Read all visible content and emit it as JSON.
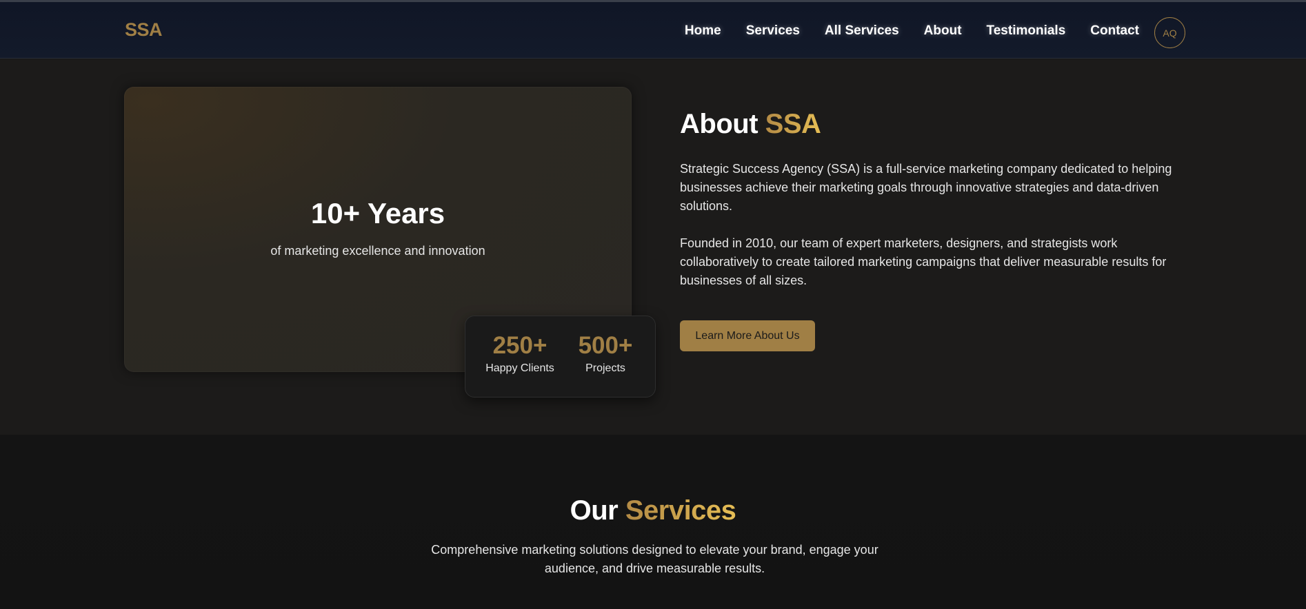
{
  "brand": {
    "logo": "SSA",
    "accent_color": "#a07f45",
    "accent_gradient": [
      "#b38a45",
      "#e6be55"
    ]
  },
  "nav": {
    "links": [
      "Home",
      "Services",
      "All Services",
      "About",
      "Testimonials",
      "Contact"
    ],
    "avatar_initials": "AQ"
  },
  "about": {
    "card": {
      "title": "10+ Years",
      "subtitle": "of marketing excellence and innovation"
    },
    "stats": [
      {
        "value": "250+",
        "label": "Happy Clients"
      },
      {
        "value": "500+",
        "label": "Projects"
      }
    ],
    "heading_prefix": "About",
    "heading_accent": "SSA",
    "paragraph_1": "Strategic Success Agency (SSA) is a full-service marketing company dedicated to helping businesses achieve their marketing goals through innovative strategies and data-driven solutions.",
    "paragraph_2": "Founded in 2010, our team of expert marketers, designers, and strategists work collaboratively to create tailored marketing campaigns that deliver measurable results for businesses of all sizes.",
    "button_label": "Learn More About Us"
  },
  "services": {
    "heading_prefix": "Our",
    "heading_accent": "Services",
    "subtitle": "Comprehensive marketing solutions designed to elevate your brand, engage your audience, and drive measurable results."
  }
}
